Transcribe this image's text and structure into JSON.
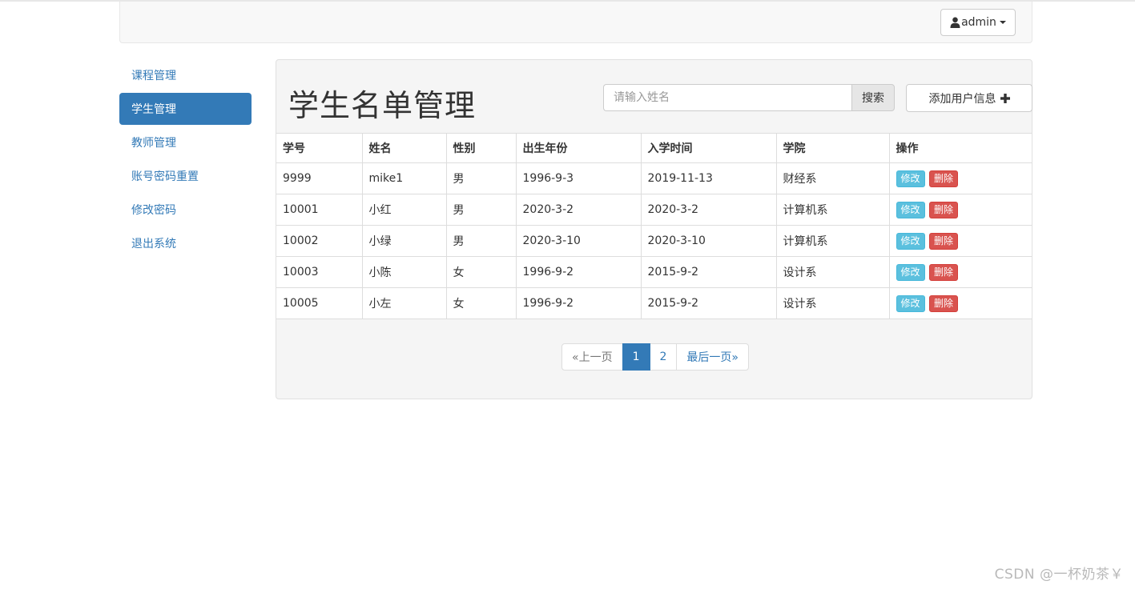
{
  "header": {
    "user_label": "admin",
    "user_icon": "user-icon"
  },
  "sidebar": {
    "items": [
      {
        "label": "课程管理",
        "active": false
      },
      {
        "label": "学生管理",
        "active": true
      },
      {
        "label": "教师管理",
        "active": false
      },
      {
        "label": "账号密码重置",
        "active": false
      },
      {
        "label": "修改密码",
        "active": false
      },
      {
        "label": "退出系统",
        "active": false
      }
    ]
  },
  "main": {
    "title": "学生名单管理",
    "search": {
      "placeholder": "请输入姓名",
      "value": "",
      "button_label": "搜索"
    },
    "add_button_label": "添加用户信息",
    "table": {
      "columns": [
        "学号",
        "姓名",
        "性别",
        "出生年份",
        "入学时间",
        "学院",
        "操作"
      ],
      "rows": [
        [
          "9999",
          "mike1",
          "男",
          "1996-9-3",
          "2019-11-13",
          "财经系"
        ],
        [
          "10001",
          "小红",
          "男",
          "2020-3-2",
          "2020-3-2",
          "计算机系"
        ],
        [
          "10002",
          "小绿",
          "男",
          "2020-3-10",
          "2020-3-10",
          "计算机系"
        ],
        [
          "10003",
          "小陈",
          "女",
          "1996-9-2",
          "2015-9-2",
          "设计系"
        ],
        [
          "10005",
          "小左",
          "女",
          "1996-9-2",
          "2015-9-2",
          "设计系"
        ]
      ],
      "edit_label": "修改",
      "delete_label": "删除"
    },
    "pagination": {
      "prev_label": "«上一页",
      "pages": [
        "1",
        "2"
      ],
      "current_page": "1",
      "last_label": "最后一页»"
    }
  },
  "watermark": "CSDN @一杯奶茶￥",
  "colors": {
    "primary": "#337ab7",
    "info": "#5bc0de",
    "danger": "#d9534f"
  }
}
